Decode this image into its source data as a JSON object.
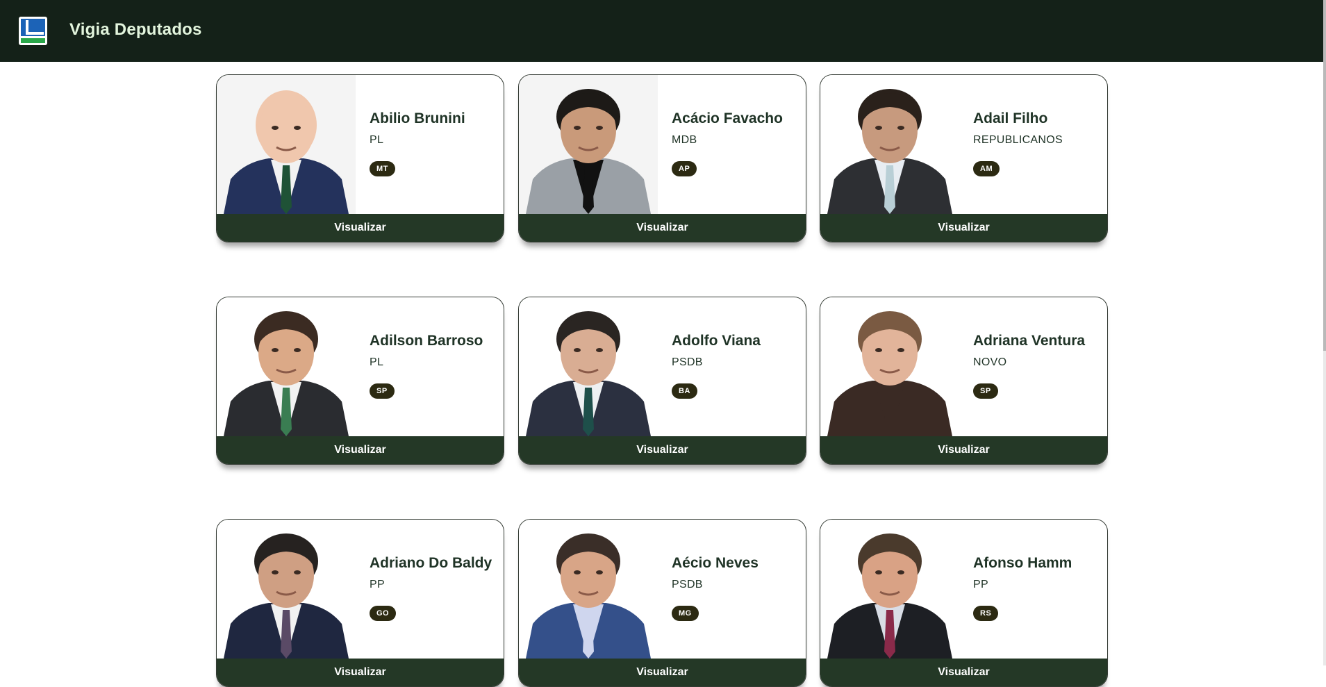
{
  "header": {
    "title": "Vigia Deputados",
    "logo_icon": "brazil-flag-logo-icon"
  },
  "colors": {
    "header_bg": "#142118",
    "button_bg": "#243826",
    "badge_bg": "#2c2a12",
    "title_text": "#e3f5dd"
  },
  "deputies": [
    {
      "name": "Abilio Brunini",
      "party": "PL",
      "uf": "MT",
      "button": "Visualizar",
      "photo": {
        "hair": "#e9c6b0",
        "skin": "#f0c7ad",
        "suit": "#24325c",
        "shirt": "#f2f2f2",
        "tie": "#1f5236",
        "bg": "#f4f4f4",
        "bald": true
      }
    },
    {
      "name": "Acácio Favacho",
      "party": "MDB",
      "uf": "AP",
      "button": "Visualizar",
      "photo": {
        "hair": "#1d1a17",
        "skin": "#c99a7a",
        "suit": "#9aa0a6",
        "shirt": "#111111",
        "tie": "#111111",
        "bg": "#f4f4f4",
        "bald": false
      }
    },
    {
      "name": "Adail Filho",
      "party": "REPUBLICANOS",
      "uf": "AM",
      "button": "Visualizar",
      "photo": {
        "hair": "#2a211b",
        "skin": "#c79a7e",
        "suit": "#2d2f33",
        "shirt": "#e8edf2",
        "tie": "#b9cfd6",
        "bg": "#ffffff",
        "bald": false
      }
    },
    {
      "name": "Adilson Barroso",
      "party": "PL",
      "uf": "SP",
      "button": "Visualizar",
      "photo": {
        "hair": "#3b2b22",
        "skin": "#dba987",
        "suit": "#2a2c30",
        "shirt": "#f2f2f2",
        "tie": "#3a7d52",
        "bg": "#ffffff",
        "bald": false
      }
    },
    {
      "name": "Adolfo Viana",
      "party": "PSDB",
      "uf": "BA",
      "button": "Visualizar",
      "photo": {
        "hair": "#2a2522",
        "skin": "#d9ad93",
        "suit": "#2b3040",
        "shirt": "#eef0f2",
        "tie": "#1e4f4a",
        "bg": "#ffffff",
        "bald": false
      }
    },
    {
      "name": "Adriana Ventura",
      "party": "NOVO",
      "uf": "SP",
      "button": "Visualizar",
      "photo": {
        "hair": "#7a5a42",
        "skin": "#e2b49a",
        "suit": "#3a2a24",
        "shirt": "#3a2a24",
        "tie": "#3a2a24",
        "bg": "#ffffff",
        "bald": false
      }
    },
    {
      "name": "Adriano Do Baldy",
      "party": "PP",
      "uf": "GO",
      "button": "Visualizar",
      "photo": {
        "hair": "#262220",
        "skin": "#cf9f83",
        "suit": "#1f2740",
        "shirt": "#f1f1f1",
        "tie": "#5a4a66",
        "bg": "#ffffff",
        "bald": false
      }
    },
    {
      "name": "Aécio Neves",
      "party": "PSDB",
      "uf": "MG",
      "button": "Visualizar",
      "photo": {
        "hair": "#3a2e28",
        "skin": "#d8a587",
        "suit": "#34508a",
        "shirt": "#cfd6ee",
        "tie": "#cfd6ee",
        "bg": "#ffffff",
        "bald": false
      }
    },
    {
      "name": "Afonso Hamm",
      "party": "PP",
      "uf": "RS",
      "button": "Visualizar",
      "photo": {
        "hair": "#4a3a2c",
        "skin": "#d9a285",
        "suit": "#1d1f24",
        "shirt": "#d9dde6",
        "tie": "#8a2a4a",
        "bg": "#ffffff",
        "bald": false
      }
    }
  ]
}
